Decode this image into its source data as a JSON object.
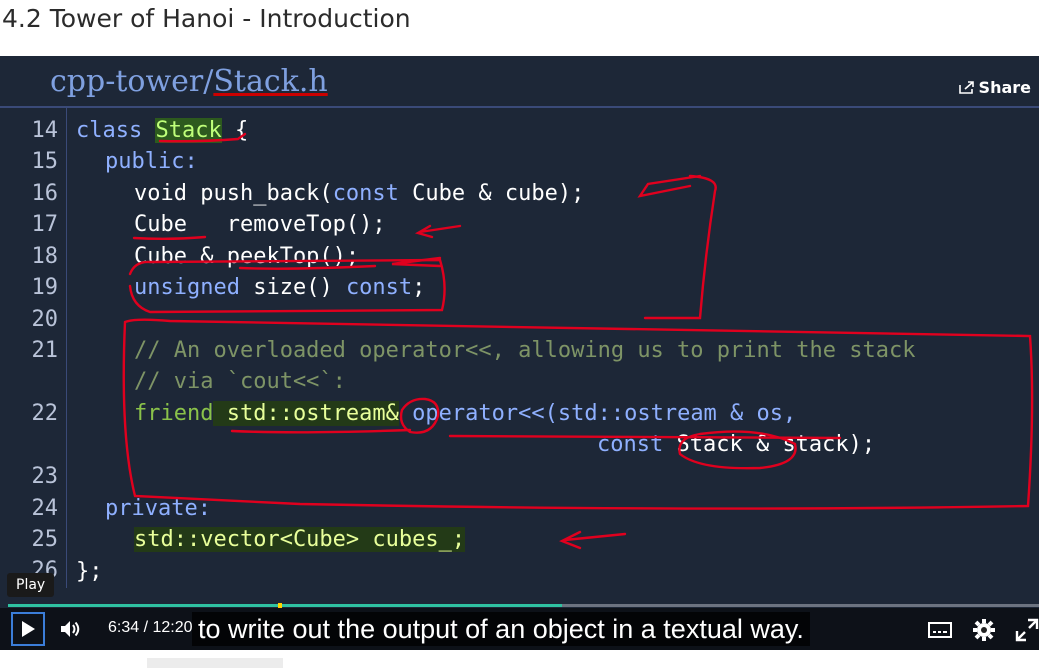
{
  "page": {
    "title": "4.2 Tower of Hanoi - Introduction"
  },
  "video": {
    "file_dir": "cpp-tower/",
    "file_name": "Stack.h",
    "share_label": "Share",
    "code": {
      "line_numbers": [
        "14",
        "15",
        "16",
        "17",
        "18",
        "19",
        "20",
        "21",
        "22",
        "23",
        "24",
        "25",
        "26"
      ],
      "l14": [
        "class ",
        "Stack",
        " {"
      ],
      "l15": "public:",
      "l16": [
        "void push_back(",
        "const",
        " Cube & cube);"
      ],
      "l17": "Cube   removeTop();",
      "l18": "Cube & peekTop();",
      "l19": [
        "unsigned",
        " size() ",
        "const",
        ";"
      ],
      "l21": "// An overloaded operator<<, allowing us to print the stack",
      "l21b": "// via `cout<<`:",
      "l22": [
        "friend",
        " std::ostream&",
        " operator<<(std::ostream & os,"
      ],
      "l22b": [
        "const",
        " Stack & stack);"
      ],
      "l24": "private:",
      "l25": "std::vector<Cube> cubes_;",
      "l26": "};"
    },
    "player": {
      "tooltip": "Play",
      "current_time": "6:34",
      "separator": "/",
      "duration": "12:20",
      "caption": "to write out the output of an object in a textual way.",
      "progress": 0.537,
      "icons": [
        "play-icon",
        "volume-icon",
        "captions-icon",
        "gear-icon",
        "fullscreen-icon",
        "share-icon"
      ]
    }
  }
}
